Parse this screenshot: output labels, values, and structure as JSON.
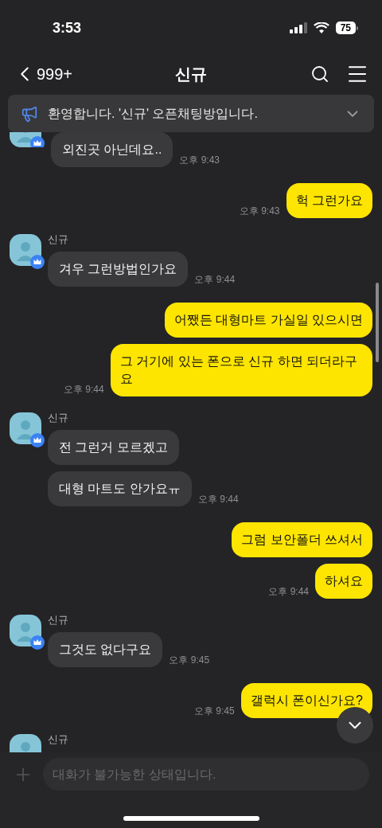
{
  "status_bar": {
    "time": "3:53",
    "battery": "75"
  },
  "header": {
    "back_count": "999+",
    "title": "신규"
  },
  "notice": {
    "text": "환영합니다. '신규' 오픈채팅방입니다."
  },
  "messages": [
    {
      "kind": "received",
      "bubbles": [
        "외진곳 아닌데요.."
      ],
      "time": "오후 9:43"
    },
    {
      "kind": "sent",
      "bubbles": [
        "헉 그런가요"
      ],
      "time": "오후 9:43"
    },
    {
      "kind": "received",
      "name": "신규",
      "bubbles": [
        "겨우 그런방법인가요"
      ],
      "time": "오후 9:44"
    },
    {
      "kind": "sent",
      "bubbles": [
        "어쨌든 대형마트 가실일 있으시면",
        "그 거기에 있는 폰으로 신규 하면 되더라구요"
      ],
      "time": "오후 9:44"
    },
    {
      "kind": "received",
      "name": "신규",
      "bubbles": [
        "전 그런거 모르겠고",
        "대형 마트도 안가요ㅠ"
      ],
      "time": "오후 9:44"
    },
    {
      "kind": "sent",
      "bubbles": [
        "그럼 보안폴더 쓰셔서",
        "하셔요"
      ],
      "time": "오후 9:44"
    },
    {
      "kind": "received",
      "name": "신규",
      "bubbles": [
        "그것도 없다구요"
      ],
      "time": "오후 9:45"
    },
    {
      "kind": "sent",
      "bubbles": [
        "갤럭시 폰이신가요?"
      ],
      "time": "오후 9:45"
    },
    {
      "kind": "received",
      "name": "신규"
    }
  ],
  "input": {
    "placeholder": "대화가 불가능한 상태입니다.",
    "disabled": true
  }
}
